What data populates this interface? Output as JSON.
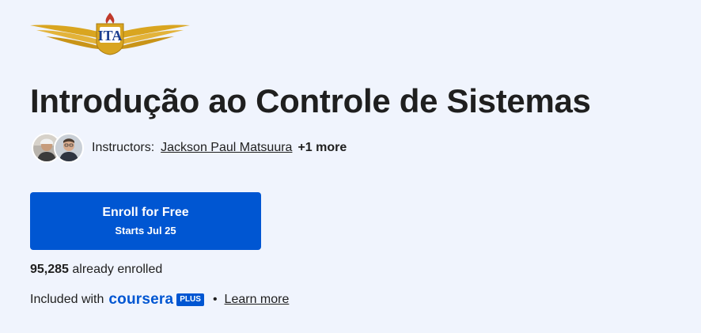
{
  "partner_logo": {
    "icon": "ita-winged-logo-icon",
    "text": "ITA",
    "colors": {
      "gold": "#d9a520",
      "blue": "#1d3f8f",
      "red": "#c0392b"
    }
  },
  "course": {
    "title": "Introdução ao Controle de Sistemas"
  },
  "instructors": {
    "label": "Instructors:",
    "primary_name": "Jackson Paul Matsuura",
    "more": "+1 more",
    "avatars": [
      "instructor-avatar-1",
      "instructor-avatar-2"
    ]
  },
  "enroll": {
    "label": "Enroll for Free",
    "sub_label": "Starts Jul 25",
    "color": "#0056d2"
  },
  "enrollment": {
    "count": "95,285",
    "suffix": "already enrolled"
  },
  "subscription": {
    "prefix": "Included with",
    "brand": "coursera",
    "badge": "PLUS",
    "separator": "•",
    "link": "Learn more",
    "brand_color": "#0056d2"
  },
  "colors": {
    "background": "#f0f4fd",
    "text": "#1f1f1f",
    "accent": "#0056d2"
  }
}
